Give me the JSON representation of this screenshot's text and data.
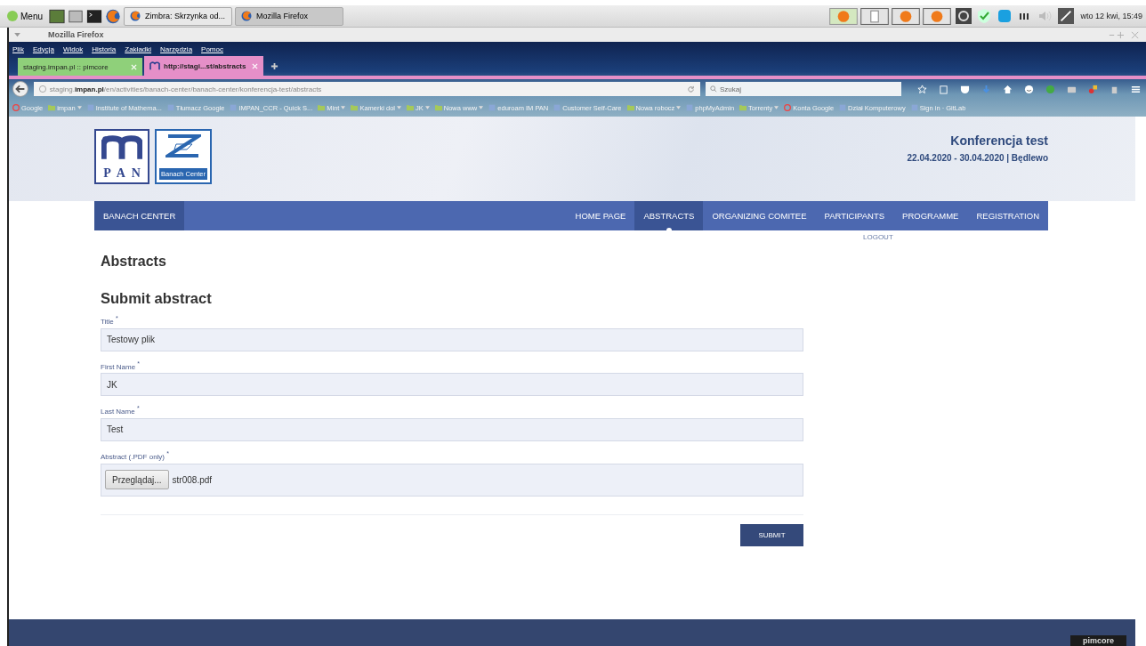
{
  "taskbar": {
    "menu_label": "Menu",
    "tasks": [
      {
        "label": "Zimbra: Skrzynka od...",
        "selected": false
      },
      {
        "label": "Mozilla Firefox",
        "selected": true
      }
    ],
    "clock": "wto 12 kwi, 15:49"
  },
  "window": {
    "title": "Mozilla Firefox"
  },
  "menu_bar": [
    "Plik",
    "Edycja",
    "Widok",
    "Historia",
    "Zakładki",
    "Narzędzia",
    "Pomoc"
  ],
  "tabs": [
    {
      "label": "staging.impan.pl :: pimcore",
      "selected": false,
      "color": "#8fd07a"
    },
    {
      "label": "http://stagi...st/abstracts",
      "selected": true,
      "color": "#e58fc8"
    }
  ],
  "address_bar": {
    "url": "staging.**impan.pl**/en/activities/banach-center/banach-center/konferencja-test/abstracts"
  },
  "search": {
    "placeholder": "Szukaj"
  },
  "bookmarks": [
    {
      "label": "Google",
      "kind": "google",
      "has_menu": false
    },
    {
      "label": "impan",
      "kind": "folder",
      "has_menu": true
    },
    {
      "label": "Institute of Mathema...",
      "kind": "site",
      "has_menu": false
    },
    {
      "label": "Tłumacz Google",
      "kind": "site",
      "has_menu": false
    },
    {
      "label": "IMPAN_CCR - Quick S...",
      "kind": "site",
      "has_menu": false
    },
    {
      "label": "Mint",
      "kind": "folder",
      "has_menu": true
    },
    {
      "label": "Kamerki dol",
      "kind": "folder",
      "has_menu": true
    },
    {
      "label": "JK",
      "kind": "folder",
      "has_menu": true
    },
    {
      "label": "Nowa www",
      "kind": "folder",
      "has_menu": true
    },
    {
      "label": "eduroam IM PAN",
      "kind": "site",
      "has_menu": false
    },
    {
      "label": "Customer Self-Care",
      "kind": "site",
      "has_menu": false
    },
    {
      "label": "Nowa robocz",
      "kind": "folder",
      "has_menu": true
    },
    {
      "label": "phpMyAdmin",
      "kind": "site",
      "has_menu": false
    },
    {
      "label": "Torrenty",
      "kind": "folder",
      "has_menu": true
    },
    {
      "label": "Konta Google",
      "kind": "google",
      "has_menu": false
    },
    {
      "label": "Dział Komputerowy",
      "kind": "site",
      "has_menu": false
    },
    {
      "label": "Sign in · GitLab",
      "kind": "site",
      "has_menu": false
    }
  ],
  "site": {
    "impan_logo_text": "PAN",
    "banach_logo_text": "Banach Center",
    "title": "Konferencja test",
    "subtitle": "22.04.2020 - 30.04.2020 | Będlewo",
    "brand_nav": "BANACH CENTER",
    "nav": [
      {
        "label": "HOME PAGE",
        "selected": false
      },
      {
        "label": "ABSTRACTS",
        "selected": true
      },
      {
        "label": "ORGANIZING COMITEE",
        "selected": false
      },
      {
        "label": "PARTICIPANTS",
        "selected": false
      },
      {
        "label": "PROGRAMME",
        "selected": false
      },
      {
        "label": "REGISTRATION",
        "selected": false
      }
    ],
    "logout": "LOGOUT"
  },
  "page": {
    "heading": "Abstracts",
    "form_title": "Submit abstract",
    "fields": [
      {
        "kind": "text",
        "label": "Title $^{*}$",
        "value": "Testowy plik"
      },
      {
        "kind": "text",
        "label": "First Name $^{*}$",
        "value": "JK"
      },
      {
        "kind": "text",
        "label": "Last Name $^{*}$",
        "value": "Test"
      },
      {
        "kind": "file",
        "label": "Abstract (.PDF only) $^{*}$",
        "button": "Przeglądaj...",
        "value": "str008.pdf"
      }
    ],
    "submit": "SUBMIT"
  },
  "footer": {
    "badge": "pimcore"
  }
}
